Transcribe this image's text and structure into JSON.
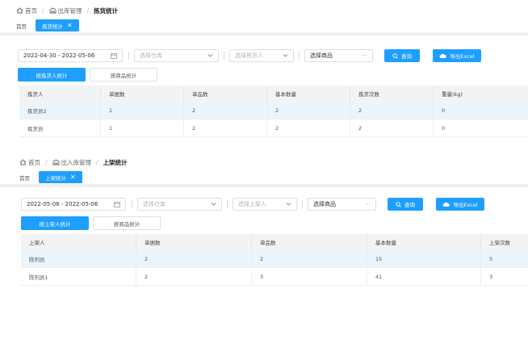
{
  "sections": [
    {
      "breadcrumb": {
        "home": "首页",
        "module": "出库管理",
        "current": "拣货统计"
      },
      "tags": {
        "home": "首页",
        "active": "拣货统计"
      },
      "filters": {
        "date_range": "2022-04-30 - 2022-05-06",
        "warehouse_placeholder": "选择仓库",
        "person_placeholder": "选择拣货人",
        "product_value": "选择商品",
        "product_suffix": "···",
        "query_label": "查询",
        "export_label": "导出Excel"
      },
      "view_tabs": {
        "active": "按拣货人统计",
        "inactive": "按商品统计"
      },
      "table": {
        "columns": [
          "拣货人",
          "单据数",
          "单品数",
          "基本数量",
          "拣货次数",
          "重量(kg)"
        ],
        "rows": [
          [
            "拣货员2",
            "1",
            "2",
            "2",
            "2",
            "0"
          ],
          [
            "拣货员",
            "1",
            "2",
            "2",
            "2",
            "0"
          ]
        ]
      }
    },
    {
      "breadcrumb": {
        "home": "首页",
        "module": "出入库管理",
        "current": "上架统计"
      },
      "tags": {
        "home": "首页",
        "active": "上架统计"
      },
      "filters": {
        "date_range": "2022-05-06 - 2022-05-06",
        "warehouse_placeholder": "选择仓库",
        "person_placeholder": "选择上架人",
        "product_value": "选择商品",
        "product_suffix": "···",
        "query_label": "查询",
        "export_label": "导出Excel"
      },
      "view_tabs": {
        "active": "按上架人统计",
        "inactive": "按商品统计"
      },
      "table": {
        "columns": [
          "上架人",
          "单据数",
          "单品数",
          "基本数量",
          "上架次数"
        ],
        "rows": [
          [
            "陈列员",
            "2",
            "2",
            "15",
            "5"
          ],
          [
            "陈列员1",
            "2",
            "3",
            "41",
            "3"
          ]
        ]
      }
    }
  ],
  "colors": {
    "primary": "#1e9fff",
    "row_highlight": "#ecf4fc",
    "header_bg": "#f2f3f5"
  }
}
